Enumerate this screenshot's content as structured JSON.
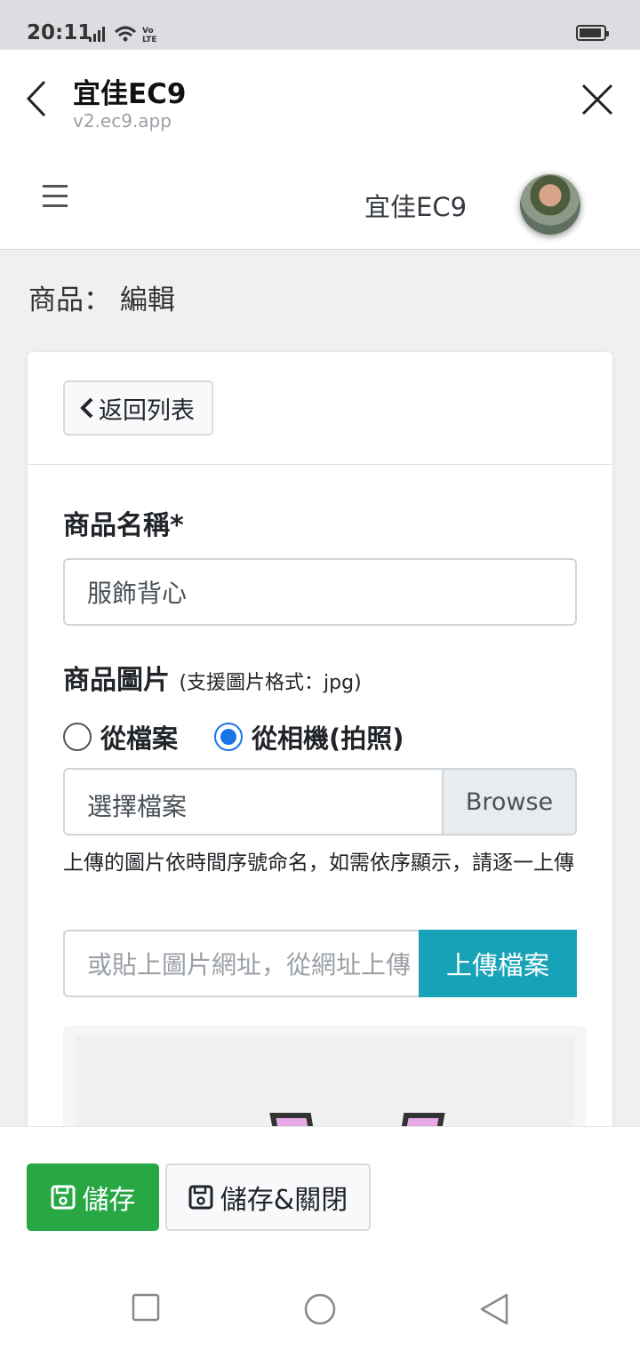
{
  "status_bar": {
    "time": "20:11"
  },
  "browser": {
    "title": "宜佳EC9",
    "url": "v2.ec9.app"
  },
  "app_nav": {
    "brand": "宜佳EC9"
  },
  "page": {
    "title": "商品： 編輯"
  },
  "card": {
    "back_button": "返回列表",
    "name_label": "商品名稱*",
    "name_value": "服飾背心",
    "image_label": "商品圖片",
    "image_format_note": "(支援圖片格式：jpg)",
    "radio_file": "從檔案",
    "radio_camera": "從相機(拍照)",
    "file_placeholder": "選擇檔案",
    "browse": "Browse",
    "hint": "上傳的圖片依時間序號命名，如需依序顯示，請逐一上傳",
    "url_placeholder": "或貼上圖片網址，從網址上傳",
    "upload_button": "上傳檔案"
  },
  "actions": {
    "save": "儲存",
    "save_close": "儲存&關閉"
  },
  "colors": {
    "save": "#28a745",
    "upload": "#17a2b8",
    "radio_selected": "#1a73e8"
  }
}
